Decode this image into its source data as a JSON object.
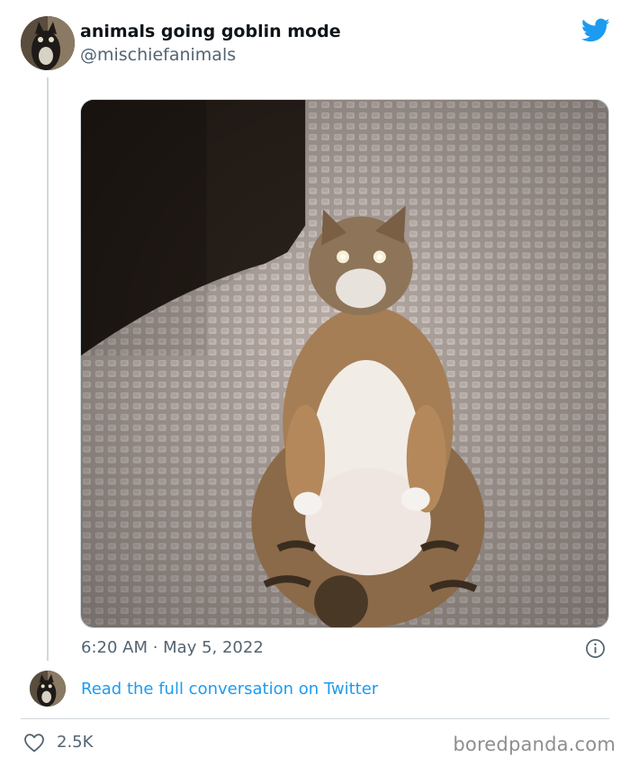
{
  "tweet": {
    "author": {
      "display_name": "animals going goblin mode",
      "handle": "@mischiefanimals"
    },
    "timestamp": "6:20 AM · May 5, 2022",
    "read_full_link": "Read the full conversation on Twitter",
    "like_count": "2.5K"
  },
  "icons": {
    "brand": "twitter-bird-icon",
    "info": "info-icon",
    "like": "heart-icon"
  },
  "colors": {
    "link_blue": "#1d9bf0",
    "muted_text": "#536471",
    "divider": "#cfd9de"
  },
  "watermark": "boredpanda.com"
}
